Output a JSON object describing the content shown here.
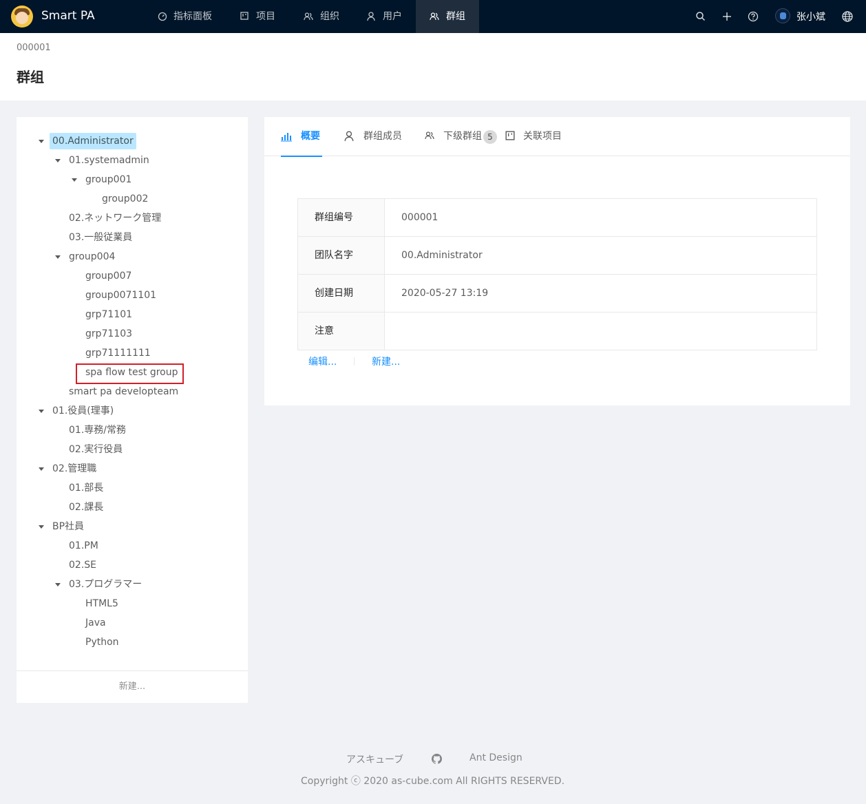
{
  "header": {
    "app_name": "Smart PA",
    "nav": [
      {
        "label": "指标面板",
        "icon": "dashboard-icon"
      },
      {
        "label": "项目",
        "icon": "project-icon"
      },
      {
        "label": "组织",
        "icon": "team-icon"
      },
      {
        "label": "用户",
        "icon": "user-icon"
      },
      {
        "label": "群组",
        "icon": "team-icon",
        "active": true
      }
    ],
    "actions": [
      "search-icon",
      "plus-icon",
      "question-circle-icon",
      "global-icon"
    ],
    "user_name": "张小斌"
  },
  "page_header": {
    "breadcrumb": "000001",
    "title": "群组"
  },
  "tree": {
    "nodes": [
      {
        "label": "00.Administrator",
        "level": 0,
        "expanded": true,
        "selected": true
      },
      {
        "label": "01.systemadmin",
        "level": 1,
        "expanded": true
      },
      {
        "label": "group001",
        "level": 2,
        "expanded": true
      },
      {
        "label": "group002",
        "level": 3
      },
      {
        "label": "02.ネットワーク管理",
        "level": 1
      },
      {
        "label": "03.一般従業員",
        "level": 1
      },
      {
        "label": "group004",
        "level": 1,
        "expanded": true
      },
      {
        "label": "group007",
        "level": 2
      },
      {
        "label": "group0071101",
        "level": 2
      },
      {
        "label": "grp71101",
        "level": 2
      },
      {
        "label": "grp71103",
        "level": 2
      },
      {
        "label": "grp71111111",
        "level": 2
      },
      {
        "label": "spa flow test group",
        "level": 2,
        "highlighted": true
      },
      {
        "label": "smart pa developteam",
        "level": 1
      },
      {
        "label": "01.役員(理事)",
        "level": 0,
        "expanded": true
      },
      {
        "label": "01.専務/常務",
        "level": 1
      },
      {
        "label": "02.実行役員",
        "level": 1
      },
      {
        "label": "02.管理職",
        "level": 0,
        "expanded": true
      },
      {
        "label": "01.部長",
        "level": 1
      },
      {
        "label": "02.課長",
        "level": 1
      },
      {
        "label": "BP社員",
        "level": 0,
        "expanded": true
      },
      {
        "label": "01.PM",
        "level": 1
      },
      {
        "label": "02.SE",
        "level": 1
      },
      {
        "label": "03.プログラマー",
        "level": 1,
        "expanded": true
      },
      {
        "label": "HTML5",
        "level": 2
      },
      {
        "label": "Java",
        "level": 2
      },
      {
        "label": "Python",
        "level": 2
      }
    ],
    "new_label": "新建..."
  },
  "detail": {
    "tabs": [
      {
        "label": "概要",
        "icon": "bar-chart-icon",
        "active": true
      },
      {
        "label": "群组成员",
        "icon": "user-icon"
      },
      {
        "label": "下级群组",
        "icon": "team-icon",
        "badge": "5"
      },
      {
        "label": "关联项目",
        "icon": "project-icon"
      }
    ],
    "fields": [
      {
        "label": "群组编号",
        "value": "000001"
      },
      {
        "label": "团队名字",
        "value": "00.Administrator"
      },
      {
        "label": "创建日期",
        "value": "2020-05-27 13:19"
      },
      {
        "label": "注意",
        "value": ""
      }
    ],
    "actions": {
      "edit": "编辑...",
      "new": "新建..."
    }
  },
  "footer": {
    "links": [
      "アスキューブ",
      "github-icon",
      "Ant Design"
    ],
    "copyright": "Copyright ⓒ 2020 as-cube.com All RIGHTS RESERVED."
  },
  "colors": {
    "header_bg": "#001529",
    "primary": "#1890ff",
    "selected_bg": "#bae7ff",
    "highlight_border": "#d21f26"
  }
}
